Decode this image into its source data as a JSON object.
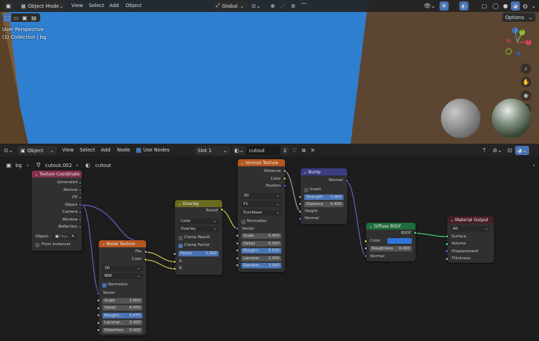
{
  "viewport_header": {
    "mode": "Object Mode",
    "menu": [
      "View",
      "Select",
      "Add",
      "Object"
    ],
    "orientation": "Global",
    "options": "Options"
  },
  "viewport": {
    "perspective": "User Perspective",
    "collection": "(1) Collection | bg",
    "gizmo": {
      "x": "X",
      "y": "Y",
      "z": "Z"
    }
  },
  "node_header": {
    "type": "Object",
    "menu": [
      "View",
      "Select",
      "Add",
      "Node"
    ],
    "use_nodes": "Use Nodes",
    "slot": "Slot 1",
    "material": "cutout",
    "users": "2"
  },
  "breadcrumb": {
    "object": "bg",
    "mesh": "cutout.002",
    "material": "cutout"
  },
  "nodes": {
    "texcoord": {
      "title": "Texture Coordinate",
      "outputs": [
        "Generated",
        "Normal",
        "UV",
        "Object",
        "Camera",
        "Window",
        "Reflection"
      ],
      "object_label": "Object:",
      "object_value": "Obje...",
      "from_instancer": "From Instancer"
    },
    "noise": {
      "title": "Noise Texture",
      "outputs": [
        "Fac",
        "Color"
      ],
      "dim": "3D",
      "basis": "fBM",
      "normalize": "Normalize",
      "vector": "Vector",
      "fields": [
        {
          "label": "Scale",
          "value": "1.000"
        },
        {
          "label": "Detail",
          "value": "4.500"
        },
        {
          "label": "Roughn...",
          "value": "0.475"
        },
        {
          "label": "Lacunar...",
          "value": "2.400"
        },
        {
          "label": "Distortion",
          "value": "0.000"
        }
      ]
    },
    "overlay": {
      "title": "Overlay",
      "result": "Result",
      "type": "Color",
      "blend": "Overlay",
      "clamp_result": "Clamp Result",
      "clamp_factor": "Clamp Factor",
      "factor_label": "Factor",
      "factor_value": "1.000",
      "inputs": [
        "A",
        "B"
      ]
    },
    "voronoi": {
      "title": "Voronoi Texture",
      "outputs": [
        "Distance",
        "Color",
        "Position"
      ],
      "dim": "3D",
      "feature": "F1",
      "metric": "Euclidean",
      "normalize": "Normalize",
      "vector": "Vector",
      "fields": [
        {
          "label": "Scale",
          "value": "0.400"
        },
        {
          "label": "Detail",
          "value": "0.000"
        },
        {
          "label": "Roughn...",
          "value": "0.500"
        },
        {
          "label": "Lacunar...",
          "value": "2.000"
        },
        {
          "label": "Random...",
          "value": "1.000"
        }
      ]
    },
    "bump": {
      "title": "Bump",
      "output": "Normal",
      "invert": "Invert",
      "strength_label": "Strength",
      "strength_value": "1.000",
      "distance_label": "Distance",
      "distance_value": "0.400",
      "inputs": [
        "Height",
        "Normal"
      ]
    },
    "diffuse": {
      "title": "Diffuse BSDF",
      "output": "BSDF",
      "color": "Color",
      "color_swatch": "#2e74d6",
      "roughness_label": "Roughness",
      "roughness_value": "0.000",
      "normal": "Normal"
    },
    "output": {
      "title": "Material Output",
      "target": "All",
      "inputs": [
        "Surface",
        "Volume",
        "Displacement",
        "Thickness"
      ]
    }
  },
  "colors": {
    "input_header": "#83314a",
    "texture_header": "#b5561f",
    "color_header": "#6a6a1e",
    "vector_header": "#3c3c83",
    "shader_header": "#1e6b3c",
    "output_header": "#4a1d25",
    "water": "#2f7fd0",
    "selection": "#4772b3"
  }
}
